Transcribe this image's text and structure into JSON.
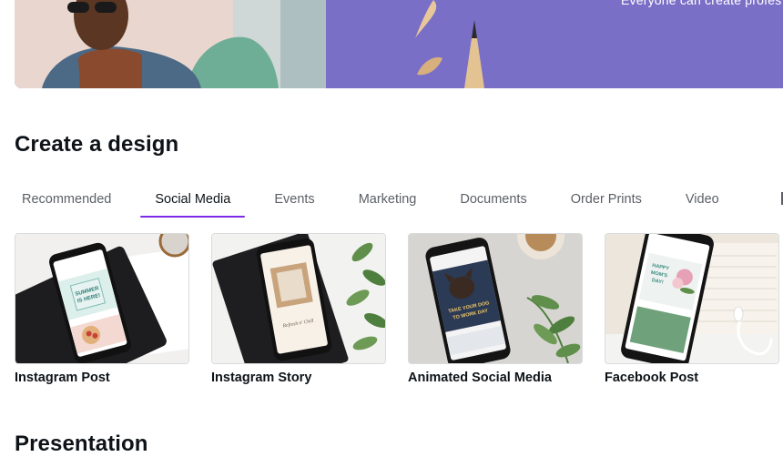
{
  "hero": {
    "tagline": "Everyone can create profes"
  },
  "create_section": {
    "title": "Create a design",
    "tabs": [
      {
        "label": "Recommended",
        "active": false
      },
      {
        "label": "Social Media",
        "active": true
      },
      {
        "label": "Events",
        "active": false
      },
      {
        "label": "Marketing",
        "active": false
      },
      {
        "label": "Documents",
        "active": false
      },
      {
        "label": "Order Prints",
        "active": false
      },
      {
        "label": "Video",
        "active": false
      }
    ],
    "cards": [
      {
        "label": "Instagram Post",
        "screen_text": [
          "SUMMER",
          "IS HERE!"
        ]
      },
      {
        "label": "Instagram Story",
        "screen_text": [
          "Refresh n' Chill"
        ]
      },
      {
        "label": "Animated Social Media",
        "screen_text": [
          "TAKE YOUR DOG",
          "TO WORK DAY"
        ]
      },
      {
        "label": "Facebook Post",
        "screen_text": [
          "HAPPY",
          "MOM'S",
          "DAY!"
        ]
      }
    ]
  },
  "next_section": {
    "title": "Presentation"
  },
  "colors": {
    "accent": "#7d2ae8",
    "hero_purple": "#7a6fc6",
    "text_primary": "#0e1318",
    "text_secondary": "#5c6066"
  }
}
